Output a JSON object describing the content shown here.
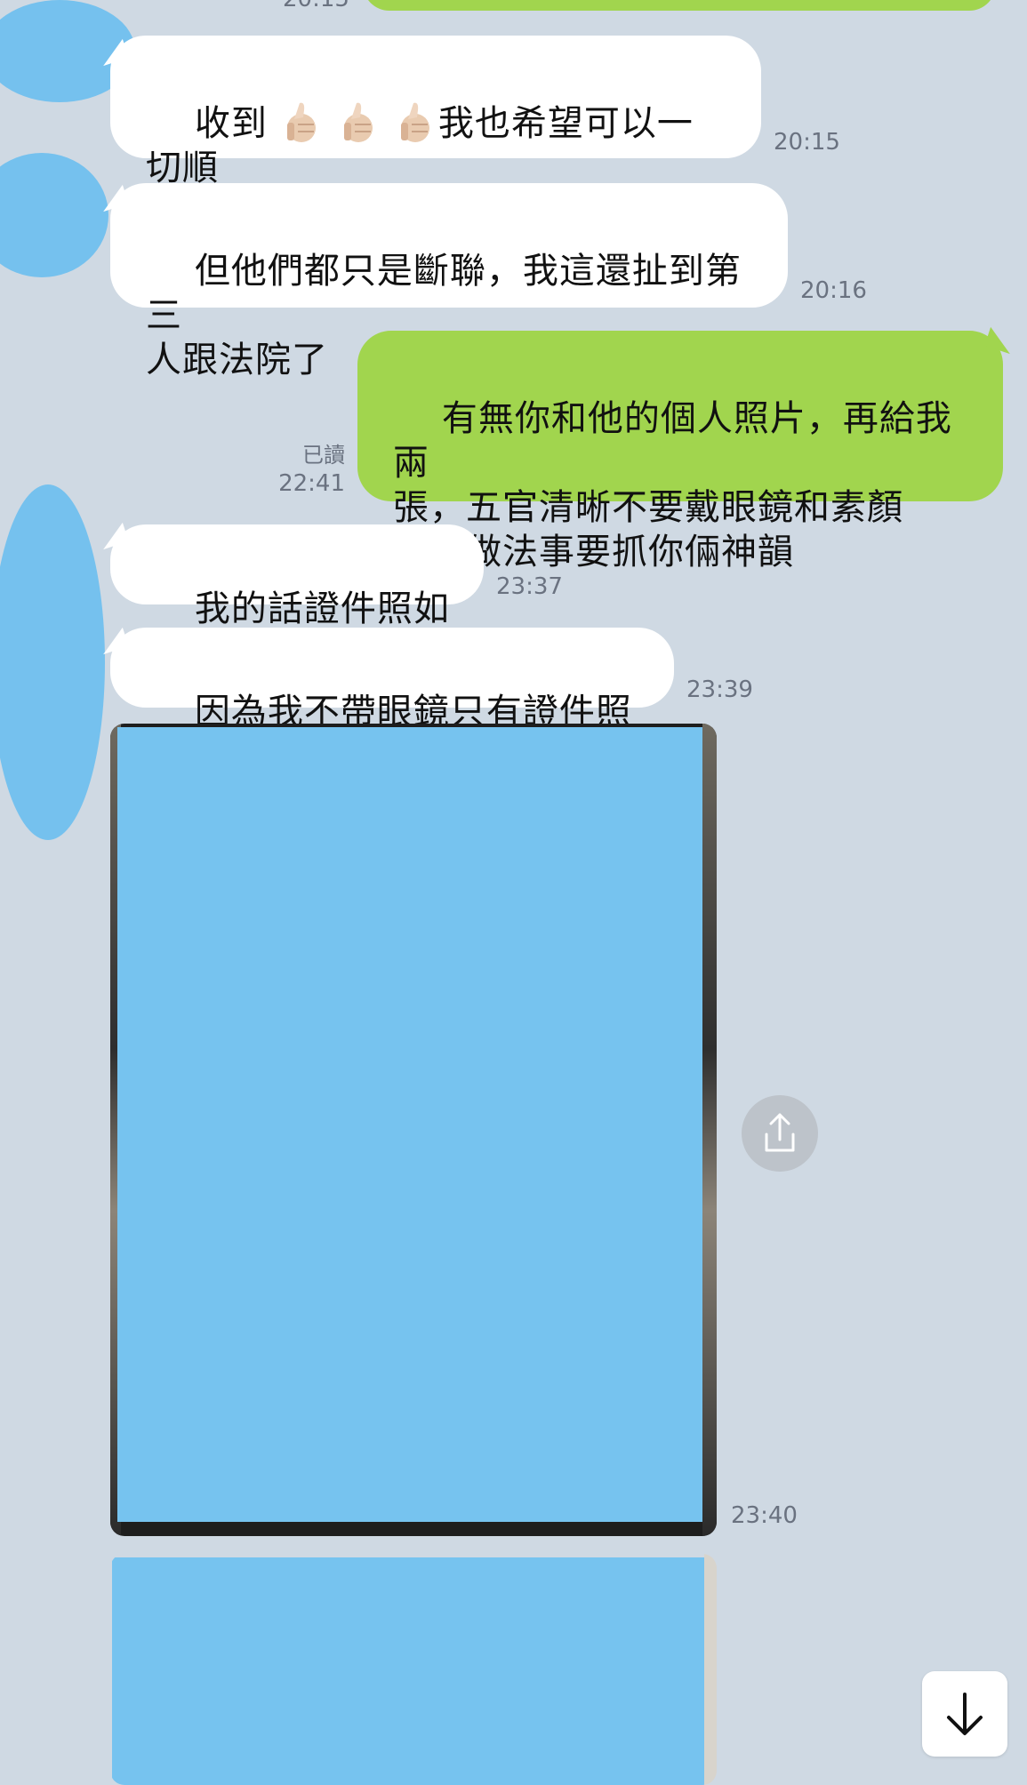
{
  "colors": {
    "background": "#cfd9e3",
    "incoming_bubble": "#ffffff",
    "outgoing_bubble": "#a1d54e",
    "redaction": "#76c3ef",
    "timestamp": "#6a7280"
  },
  "top_partial": {
    "time": "20:15"
  },
  "messages": [
    {
      "direction": "incoming",
      "text_before": "收到",
      "thumbs": 3,
      "text_after": "我也希望可以一切順\n利",
      "time": "20:15"
    },
    {
      "direction": "incoming",
      "text": "但他們都只是斷聯，我這還扯到第三\n人跟法院了",
      "time": "20:16"
    },
    {
      "direction": "outgoing",
      "text": "有無你和他的個人照片，再給我兩\n張，五官清晰不要戴眼鏡和素顏\n晚點做法事要抓你倆神韻",
      "read": "已讀",
      "time": "22:41"
    },
    {
      "direction": "incoming",
      "text": "我的話證件照如何",
      "time": "23:37"
    },
    {
      "direction": "incoming",
      "text": "因為我不帶眼鏡只有證件照了",
      "time": "23:39"
    },
    {
      "direction": "incoming",
      "type": "image",
      "time": "23:40"
    },
    {
      "direction": "incoming",
      "type": "image"
    }
  ],
  "icons": {
    "thumbs": "thumbs-up-emoji",
    "share": "share-icon",
    "scroll_down": "arrow-down-icon"
  }
}
